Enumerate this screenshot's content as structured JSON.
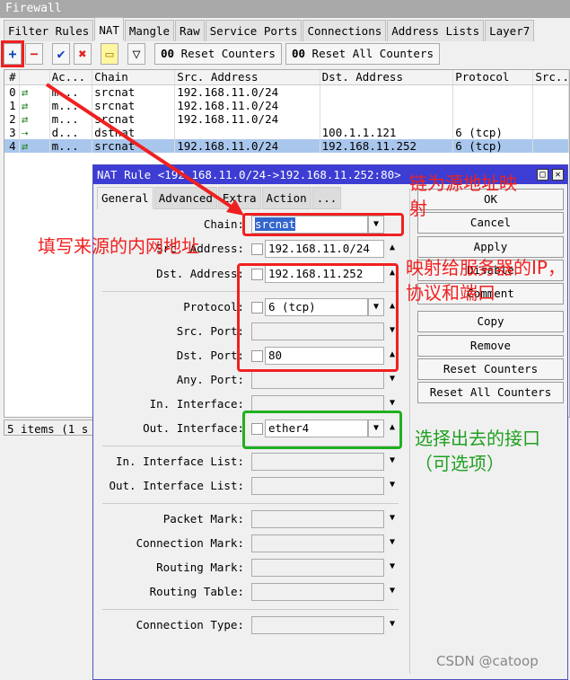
{
  "window": {
    "title": "Firewall"
  },
  "tabs": [
    "Filter Rules",
    "NAT",
    "Mangle",
    "Raw",
    "Service Ports",
    "Connections",
    "Address Lists",
    "Layer7"
  ],
  "toolbar": {
    "add": "+",
    "remove": "−",
    "enable": "✔",
    "disable": "✖",
    "comment": "▭",
    "filter": "▽",
    "reset_counters": "Reset Counters",
    "reset_all_counters": "Reset All Counters",
    "counter_glyph": "00"
  },
  "table": {
    "headers": [
      "#",
      "",
      "Ac...",
      "Chain",
      "Src. Address",
      "Dst. Address",
      "Protocol",
      "Src..."
    ],
    "rows": [
      [
        "0",
        "⇄",
        "m...",
        "srcnat",
        "192.168.11.0/24",
        "",
        "",
        ""
      ],
      [
        "1",
        "⇄",
        "m...",
        "srcnat",
        "192.168.11.0/24",
        "",
        "",
        ""
      ],
      [
        "2",
        "⇄",
        "m...",
        "srcnat",
        "192.168.11.0/24",
        "",
        "",
        ""
      ],
      [
        "3",
        "⇢",
        "d...",
        "dstnat",
        "",
        "100.1.1.121",
        "6 (tcp)",
        ""
      ],
      [
        "4",
        "⇄",
        "m...",
        "srcnat",
        "192.168.11.0/24",
        "192.168.11.252",
        "6 (tcp)",
        ""
      ]
    ],
    "selected_row": 4
  },
  "status": "5 items (1 s",
  "dialog": {
    "title": "NAT Rule <192.168.11.0/24->192.168.11.252:80>",
    "tabs": [
      "General",
      "Advanced",
      "Extra",
      "Action",
      "..."
    ],
    "buttons": [
      "OK",
      "Cancel",
      "Apply",
      "Disable",
      "Comment",
      "Copy",
      "Remove",
      "Reset Counters",
      "Reset All Counters"
    ],
    "fields": {
      "chain": {
        "label": "Chain:",
        "value": "srcnat"
      },
      "src_address": {
        "label": "Src. Address:",
        "value": "192.168.11.0/24"
      },
      "dst_address": {
        "label": "Dst. Address:",
        "value": "192.168.11.252"
      },
      "protocol": {
        "label": "Protocol:",
        "value": "6 (tcp)"
      },
      "src_port": {
        "label": "Src. Port:",
        "value": ""
      },
      "dst_port": {
        "label": "Dst. Port:",
        "value": "80"
      },
      "any_port": {
        "label": "Any. Port:",
        "value": ""
      },
      "in_interface": {
        "label": "In. Interface:",
        "value": ""
      },
      "out_interface": {
        "label": "Out. Interface:",
        "value": "ether4"
      },
      "in_interface_list": {
        "label": "In. Interface List:",
        "value": ""
      },
      "out_interface_list": {
        "label": "Out. Interface List:",
        "value": ""
      },
      "packet_mark": {
        "label": "Packet Mark:",
        "value": ""
      },
      "connection_mark": {
        "label": "Connection Mark:",
        "value": ""
      },
      "routing_mark": {
        "label": "Routing Mark:",
        "value": ""
      },
      "routing_table": {
        "label": "Routing Table:",
        "value": ""
      },
      "connection_type": {
        "label": "Connection Type:",
        "value": ""
      }
    }
  },
  "annotations": {
    "src": "填写来源的内网地址",
    "chain": "链为源地址映射",
    "dst": "映射给服务器的IP，协议和端口",
    "out": "选择出去的接口（可选项）",
    "color_red": "#f02020",
    "color_green": "#20a020"
  },
  "watermark": "CSDN @catoop"
}
